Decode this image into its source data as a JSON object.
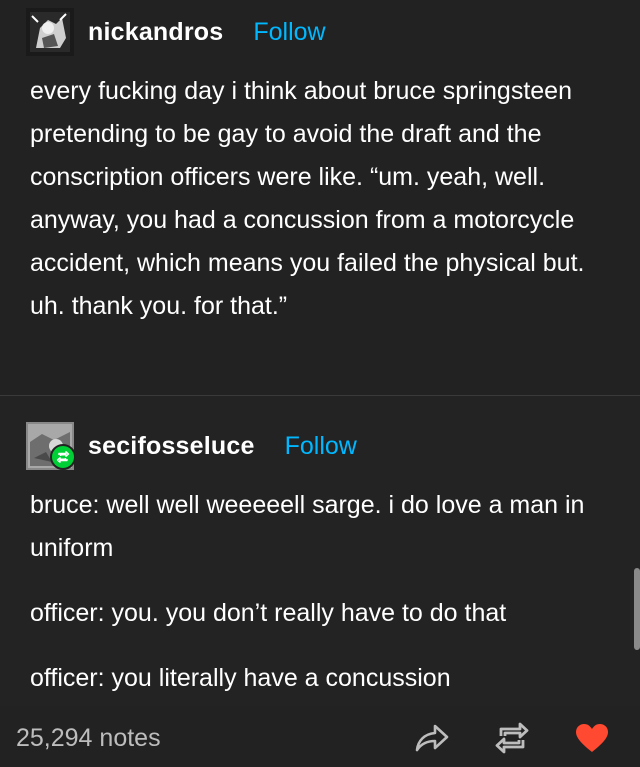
{
  "post1": {
    "username": "nickandros",
    "follow_label": "Follow",
    "text": "every fucking day i think about bruce springsteen pretending to be gay to avoid the draft and the conscription officers were like. “um. yeah, well. anyway, you had a concussion from a motorcycle accident, which means you failed the physical but. uh. thank you. for that.”"
  },
  "post2": {
    "username": "secifosseluce",
    "follow_label": "Follow",
    "paragraphs": [
      "bruce: well well weeeeell sarge. i do love a man in uniform",
      "officer: you. you don’t really have to do that",
      "officer: you literally have a concussion"
    ]
  },
  "footer": {
    "notes": "25,294 notes",
    "actions": [
      "share-icon",
      "reblog-icon",
      "like-icon"
    ]
  },
  "colors": {
    "background": "#222222",
    "follow": "#00b8ff",
    "like": "#ff4930",
    "reblog_badge": "#00cf35"
  }
}
